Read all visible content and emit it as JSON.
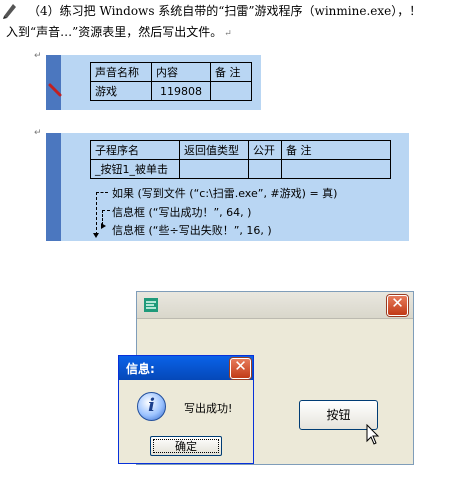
{
  "document": {
    "line1": "（4）练习把 Windows 系统自带的“扫雷”游戏程序（winmine.exe），！",
    "line2": "入到“声音…”资源表里，然后写出文件。",
    "return_mark": "↵"
  },
  "resource_table": {
    "headers": [
      "声音名称",
      "内容",
      "备 注"
    ],
    "row": [
      "游戏",
      "119808",
      ""
    ]
  },
  "sub_table": {
    "headers": [
      "子程序名",
      "返回值类型",
      "公开",
      "备 注"
    ],
    "row": [
      "_按钮1_被单击",
      "",
      "",
      ""
    ]
  },
  "code": {
    "line1": "如果 (写到文件 (“c:\\扫雷.exe”, #游戏) = 真)",
    "line2": "信息框 (“写出成功！”, 64, )",
    "line3": "信息框 (“些÷写出失败！”, 16, )"
  },
  "main_window": {
    "close_glyph": "✕",
    "button_label": "按钮"
  },
  "message_box": {
    "title": "信息:",
    "close_glyph": "✕",
    "icon_glyph": "i",
    "text": "写出成功!",
    "ok_label": "确定"
  }
}
